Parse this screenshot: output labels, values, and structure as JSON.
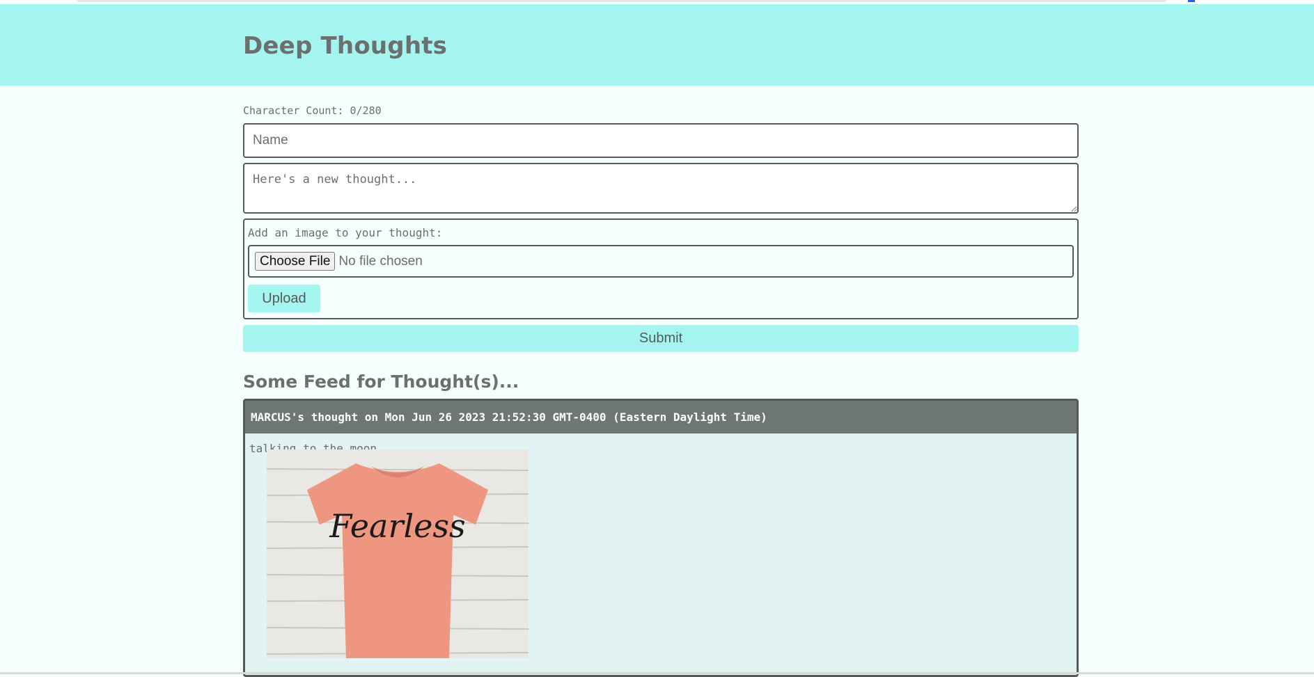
{
  "header": {
    "title": "Deep Thoughts"
  },
  "form": {
    "character_count": "Character Count: 0/280",
    "name_placeholder": "Name",
    "thought_placeholder": "Here's a new thought...",
    "image_label": "Add an image to your thought:",
    "choose_file_label": "Choose File",
    "no_file_text": "No file chosen",
    "upload_label": "Upload",
    "submit_label": "Submit"
  },
  "feed": {
    "title": "Some Feed for Thought(s)...",
    "thoughts": [
      {
        "header": "MARCUS's thought on Mon Jun 26 2023 21:52:30 GMT-0400 (Eastern Daylight Time)",
        "text": "talking to the moon...",
        "image_text": "Fearless"
      }
    ]
  },
  "colors": {
    "accent": "#a4f5ef",
    "background": "#f5fffd",
    "card_header": "#6e7776",
    "card_body": "#e1f3f2",
    "shirt": "#ee9680"
  }
}
